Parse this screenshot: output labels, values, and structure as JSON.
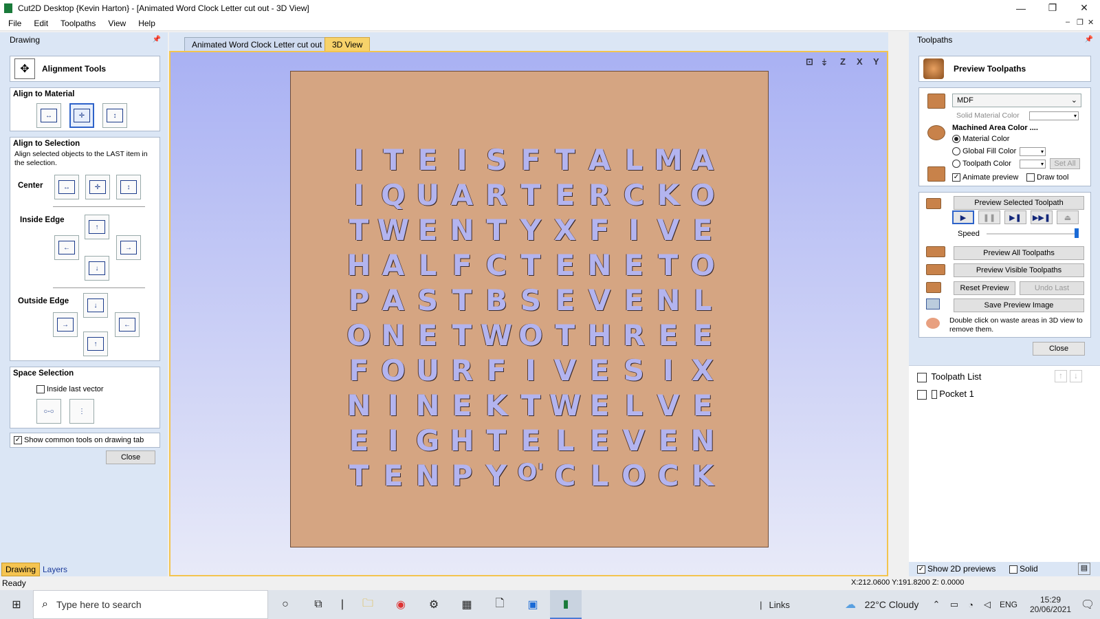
{
  "window": {
    "title": "Cut2D Desktop {Kevin Harton} - [Animated Word Clock Letter cut out - 3D View]",
    "minimize": "—",
    "maximize": "❐",
    "close": "✕"
  },
  "menu": [
    "File",
    "Edit",
    "Toolpaths",
    "View",
    "Help"
  ],
  "left_panel": {
    "title": "Drawing",
    "alignment_tools": "Alignment Tools",
    "align_to_material": "Align to Material",
    "align_to_selection": "Align to Selection",
    "selection_desc": "Align selected objects to the LAST item in the selection.",
    "center": "Center",
    "inside_edge": "Inside Edge",
    "outside_edge": "Outside Edge",
    "space_selection": "Space Selection",
    "inside_last_vector": "Inside last vector",
    "show_common_tools": "Show common tools on drawing tab",
    "close": "Close"
  },
  "bottom_tabs": [
    "Drawing",
    "Layers"
  ],
  "doc_tabs": [
    "Animated Word Clock Letter cut out",
    "3D View"
  ],
  "view_icons": [
    "⊡",
    "⤈",
    "Z",
    "X",
    "Y"
  ],
  "word_grid": [
    [
      "I",
      "T",
      "E",
      "I",
      "S",
      "F",
      "T",
      "A",
      "L",
      "M",
      "A"
    ],
    [
      "I",
      "Q",
      "U",
      "A",
      "R",
      "T",
      "E",
      "R",
      "C",
      "K",
      "O"
    ],
    [
      "T",
      "W",
      "E",
      "N",
      "T",
      "Y",
      "X",
      "F",
      "I",
      "V",
      "E"
    ],
    [
      "H",
      "A",
      "L",
      "F",
      "C",
      "T",
      "E",
      "N",
      "E",
      "T",
      "O"
    ],
    [
      "P",
      "A",
      "S",
      "T",
      "B",
      "S",
      "E",
      "V",
      "E",
      "N",
      "L"
    ],
    [
      "O",
      "N",
      "E",
      "T",
      "W",
      "O",
      "T",
      "H",
      "R",
      "E",
      "E"
    ],
    [
      "F",
      "O",
      "U",
      "R",
      "F",
      "I",
      "V",
      "E",
      "S",
      "I",
      "X"
    ],
    [
      "N",
      "I",
      "N",
      "E",
      "K",
      "T",
      "W",
      "E",
      "L",
      "V",
      "E"
    ],
    [
      "E",
      "I",
      "G",
      "H",
      "T",
      "E",
      "L",
      "E",
      "V",
      "E",
      "N"
    ],
    [
      "T",
      "E",
      "N",
      "P",
      "Y",
      "O'",
      "C",
      "L",
      "O",
      "C",
      "K"
    ]
  ],
  "right_panel": {
    "title": "Toolpaths",
    "preview_toolpaths": "Preview Toolpaths",
    "material": "MDF",
    "solid_material_color": "Solid Material Color",
    "machined_area_color": "Machined Area Color ....",
    "material_color": "Material Color",
    "global_fill_color": "Global Fill Color",
    "toolpath_color": "Toolpath Color",
    "set_all": "Set All",
    "animate_preview": "Animate preview",
    "draw_tool": "Draw tool",
    "preview_selected": "Preview Selected Toolpath",
    "speed": "Speed",
    "speed_level_percent": 100,
    "preview_all": "Preview All Toolpaths",
    "preview_visible": "Preview Visible Toolpaths",
    "reset_preview": "Reset Preview",
    "undo_last": "Undo Last",
    "save_preview_image": "Save Preview Image",
    "hint": "Double click on waste areas in 3D view to remove them.",
    "close": "Close",
    "toolpath_list": "Toolpath List",
    "pocket": "Pocket 1",
    "show_2d_previews": "Show 2D previews",
    "solid": "Solid"
  },
  "status": {
    "ready": "Ready",
    "coords": "X:212.0600 Y:191.8200 Z:  0.0000"
  },
  "taskbar": {
    "search_placeholder": "Type here to search",
    "links": "Links",
    "weather": "22°C  Cloudy",
    "lang": "ENG",
    "time": "15:29",
    "date": "20/06/2021"
  }
}
